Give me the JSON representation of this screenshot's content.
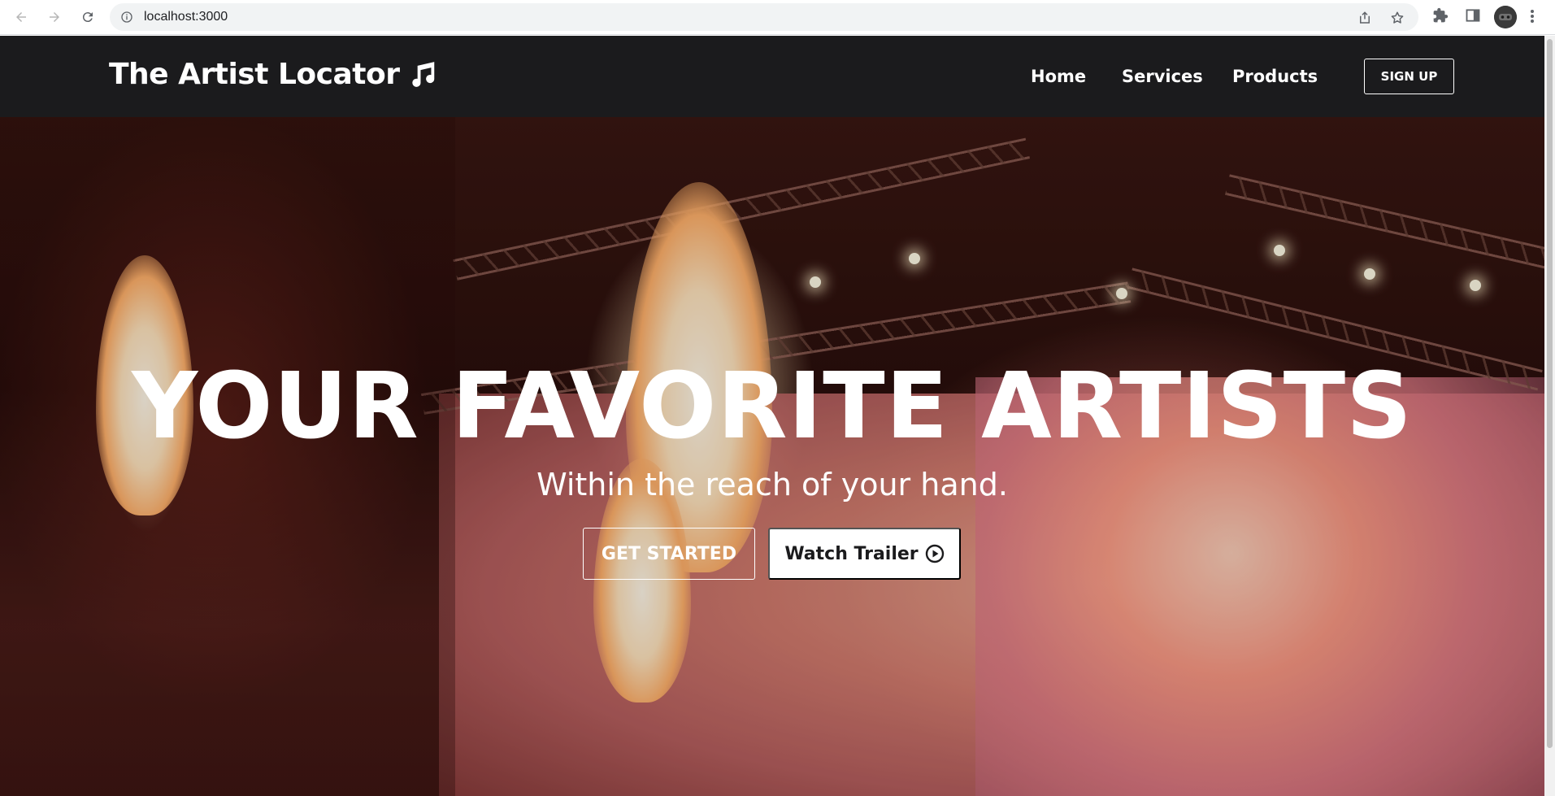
{
  "browser": {
    "url": "localhost:3000",
    "icons": {
      "back": "arrow-left-icon",
      "forward": "arrow-right-icon",
      "reload": "reload-icon",
      "info": "info-icon",
      "share": "share-icon",
      "bookmark": "star-icon",
      "extensions": "puzzle-icon",
      "sidepanel": "side-panel-icon",
      "menu": "kebab-menu-icon"
    }
  },
  "navbar": {
    "brand": "The Artist Locator",
    "brand_icon": "music-note-icon",
    "links": [
      {
        "label": "Home"
      },
      {
        "label": "Services"
      },
      {
        "label": "Products"
      }
    ],
    "signup_label": "SIGN UP",
    "background": "#1b1b1d"
  },
  "hero": {
    "title": "YOUR FAVORITE ARTISTS",
    "subtitle": "Within the reach of your hand.",
    "primary_button": "GET STARTED",
    "secondary_button": "Watch Trailer",
    "secondary_icon": "play-circle-icon"
  }
}
